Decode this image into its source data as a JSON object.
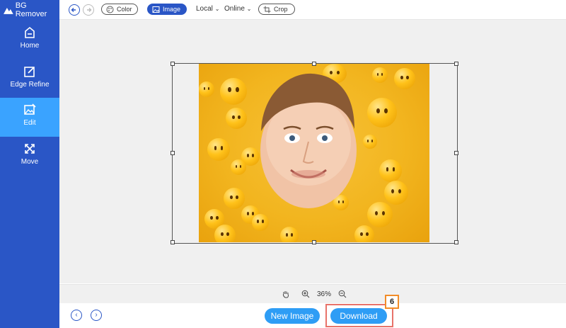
{
  "app": {
    "title": "BG Remover"
  },
  "sidebar": {
    "items": [
      {
        "label": "Home",
        "icon": "home-icon",
        "active": false
      },
      {
        "label": "Edge Refine",
        "icon": "edit-icon",
        "active": false
      },
      {
        "label": "Edit",
        "icon": "image-edit-icon",
        "active": true
      },
      {
        "label": "Move",
        "icon": "move-icon",
        "active": false
      }
    ]
  },
  "toolbar": {
    "color_label": "Color",
    "image_label": "Image",
    "local_label": "Local",
    "online_label": "Online",
    "crop_label": "Crop"
  },
  "zoom": {
    "value": "36%"
  },
  "footer": {
    "new_image_label": "New Image",
    "download_label": "Download",
    "step_badge": "6"
  },
  "colors": {
    "sidebar": "#2a56c6",
    "active": "#3aa3ff",
    "button": "#2e9df5",
    "highlight": "#e8736a",
    "badge": "#f28c28"
  }
}
